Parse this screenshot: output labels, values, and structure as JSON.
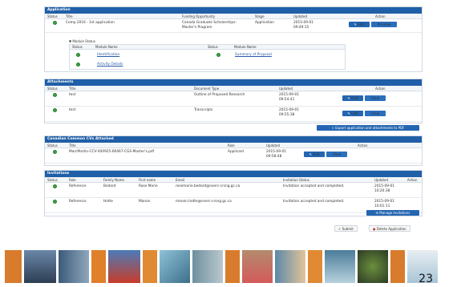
{
  "application": {
    "header": "Application",
    "cols": {
      "status": "Status",
      "title": "Title",
      "funding": "Funding Opportunity",
      "stage": "Stage",
      "updated": "Updated",
      "action": "Action"
    },
    "row": {
      "title": "Comp 2016 - 1st application",
      "funding_line1": "Canada Graduate Scholarships-",
      "funding_line2": "Master's Program",
      "stage": "Application",
      "updated_line1": "2015-09-01",
      "updated_line2": "09:49:15",
      "edit": "Edit",
      "preview": "Preview"
    },
    "module_status": {
      "label": "Module Status",
      "cols": {
        "status": "Status",
        "module_name": "Module Name",
        "status2": "Status",
        "module_name2": "Module Name"
      },
      "items": {
        "identification": "Identification",
        "summary": "Summary of Proposal",
        "activity": "Activity Details"
      }
    }
  },
  "attachments": {
    "header": "Attachments",
    "cols": {
      "status": "Status",
      "title": "Title",
      "doc_type": "Document Type",
      "updated": "Updated",
      "action": "Action"
    },
    "rows": [
      {
        "title": "test",
        "doc_type": "Outline of Proposed Research",
        "updated_line1": "2015-09-01",
        "updated_line2": "09:54:41",
        "edit": "Edit",
        "view": "View"
      },
      {
        "title": "test",
        "doc_type": "Transcripts",
        "updated_line1": "2015-09-01",
        "updated_line2": "09:55:38",
        "edit": "Edit",
        "view": "View"
      }
    ],
    "export_label": "Export application and attachments to PDF"
  },
  "ccv": {
    "header": "Canadian Common CVs Attached",
    "cols": {
      "status": "Status",
      "title": "Title",
      "role": "Role",
      "updated": "Updated",
      "action": "Action"
    },
    "row": {
      "title": "MarcMartin-CCV-400925-60467-CGS-Master's.pdf",
      "role": "Applicant",
      "updated_line1": "2015-09-01",
      "updated_line2": "09:58:48",
      "edit": "Edit",
      "view": "View"
    }
  },
  "invitations": {
    "header": "Invitations",
    "cols": {
      "status": "Status",
      "role": "Role",
      "family": "Family Name",
      "first": "First name",
      "email": "Email",
      "inv_status": "Invitation Status",
      "updated": "Updated",
      "action": "Action"
    },
    "rows": [
      {
        "role": "Reference",
        "family": "Bedard",
        "first": "Rose Marie",
        "email": "rosemarie.bedard@nserc-crsng.gc.ca",
        "status": "Invitation accepted and completed.",
        "updated_line1": "2015-09-01",
        "updated_line2": "10:20:38"
      },
      {
        "role": "Reference",
        "family": "Hotte",
        "first": "Manon",
        "email": "manon.hotte@nserc-crsng.gc.ca",
        "status": "Invitation accepted and completed.",
        "updated_line1": "2015-09-01",
        "updated_line2": "10:01:11"
      }
    ],
    "manage_label": "Manage Invitations"
  },
  "footer": {
    "submit": "Submit",
    "delete": "Delete Application"
  },
  "page_number": "23",
  "colors": {
    "header_blue": "#1f5fa7",
    "button_blue": "#2466b1",
    "status_green": "#3aa33f",
    "delete_red": "#c0392b"
  }
}
